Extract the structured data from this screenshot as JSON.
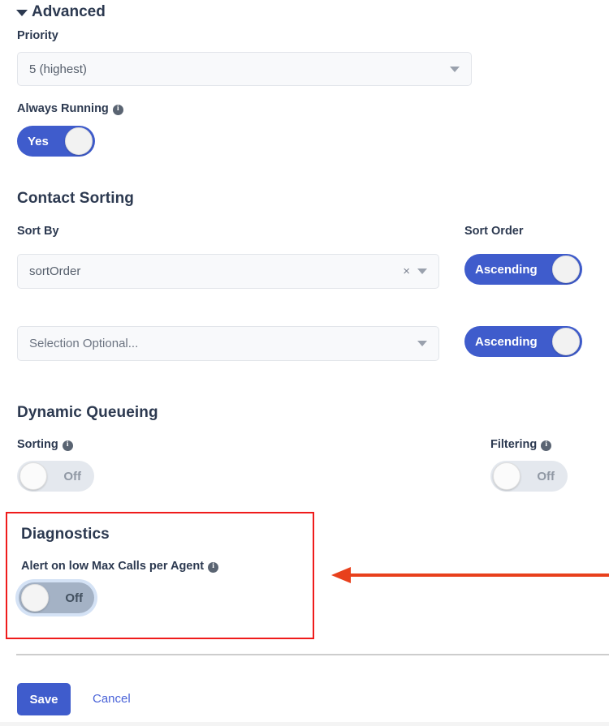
{
  "advanced": {
    "title": "Advanced",
    "collapse_icon": "chevron-down-icon",
    "priority": {
      "label": "Priority",
      "value": "5 (highest)",
      "caret_icon": "chevron-down-icon"
    },
    "always_running": {
      "label": "Always Running",
      "info_icon": "info-icon",
      "toggle_value": "Yes",
      "state": "on"
    }
  },
  "contact_sorting": {
    "title": "Contact Sorting",
    "sort_by_label": "Sort By",
    "sort_order_label": "Sort Order",
    "rows": [
      {
        "value": "sortOrder",
        "is_placeholder": false,
        "clear_icon": "close-icon",
        "clear_glyph": "×",
        "caret_icon": "chevron-down-icon",
        "order_value": "Ascending",
        "order_state": "on"
      },
      {
        "value": "Selection Optional...",
        "is_placeholder": true,
        "caret_icon": "chevron-down-icon",
        "order_value": "Ascending",
        "order_state": "on"
      }
    ]
  },
  "dynamic_queueing": {
    "title": "Dynamic Queueing",
    "sorting": {
      "label": "Sorting",
      "info_icon": "info-icon",
      "toggle_value": "Off",
      "state": "off"
    },
    "filtering": {
      "label": "Filtering",
      "info_icon": "info-icon",
      "toggle_value": "Off",
      "state": "off"
    }
  },
  "diagnostics": {
    "title": "Diagnostics",
    "alert": {
      "label": "Alert on low Max Calls per Agent",
      "info_icon": "info-icon",
      "toggle_value": "Off",
      "state": "off-focused"
    },
    "highlight_color": "#ef1b1b"
  },
  "annotation": {
    "arrow_icon": "arrow-left-icon",
    "arrow_color": "#e8401c"
  },
  "footer": {
    "save_label": "Save",
    "cancel_label": "Cancel",
    "save_color": "#3f5ccc",
    "cancel_color": "#4a63d8"
  }
}
